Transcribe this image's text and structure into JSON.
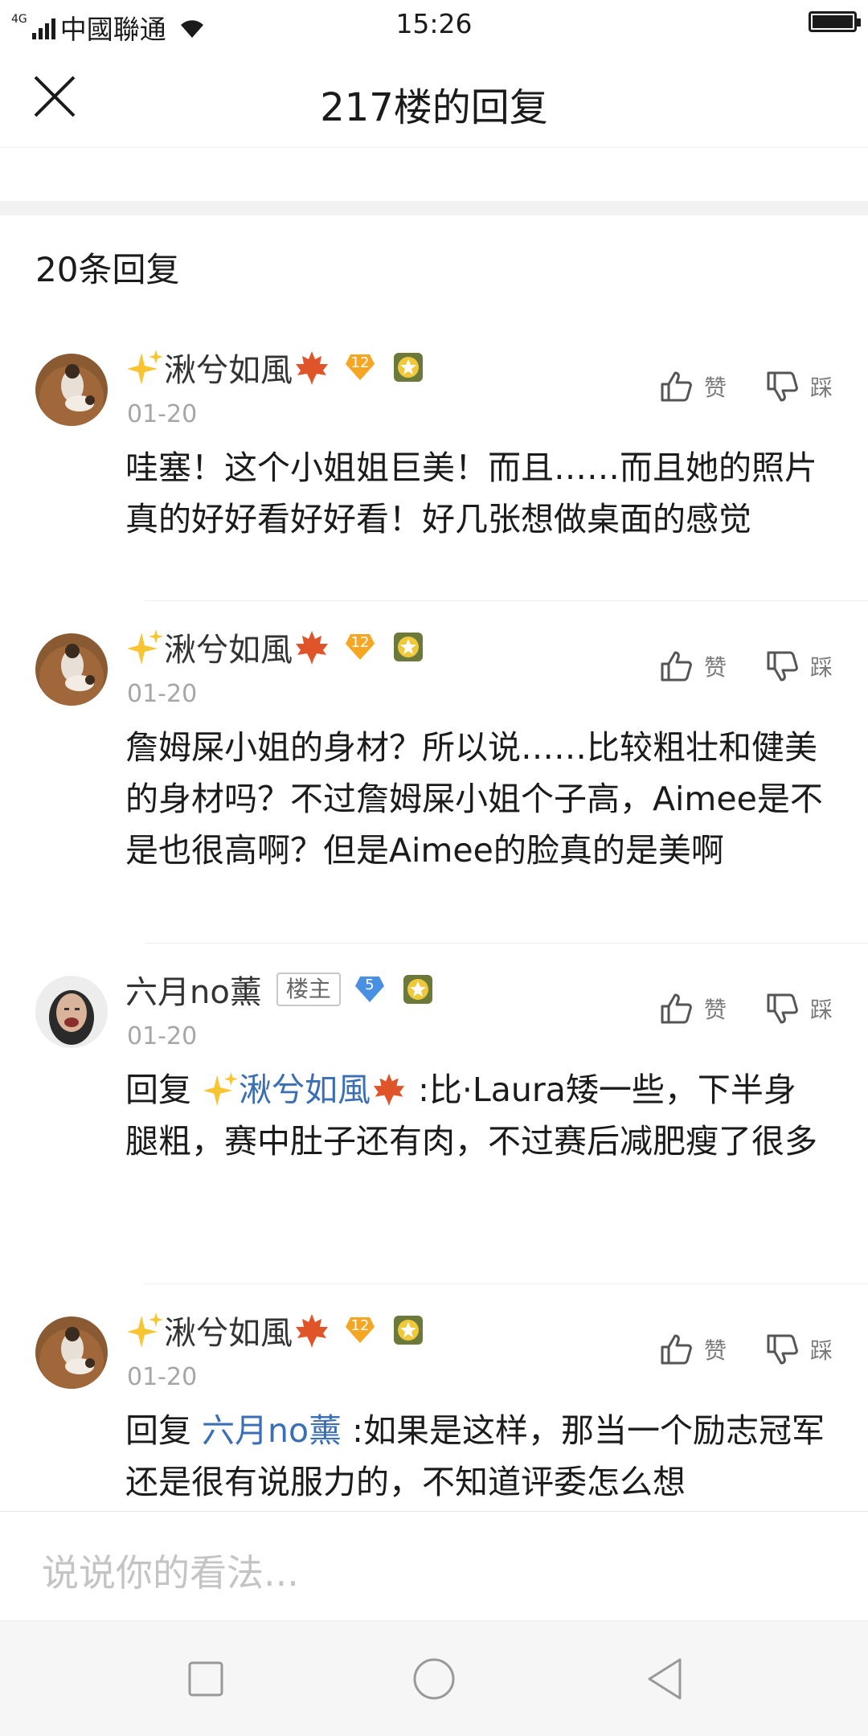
{
  "status_bar": {
    "network": "4G",
    "carrier": "中國聯通",
    "time": "15:26"
  },
  "header": {
    "title": "217楼的回复"
  },
  "reply_count": "20条回复",
  "actions": {
    "like_label": "赞",
    "dislike_label": "踩"
  },
  "comments": [
    {
      "name": "湫兮如風",
      "level": "12",
      "date": "01-20",
      "text": "哇塞！这个小姐姐巨美！而且……而且她的照片真的好好看好好看！好几张想做桌面的感觉"
    },
    {
      "name": "湫兮如風",
      "level": "12",
      "date": "01-20",
      "text": "詹姆屎小姐的身材？所以说……比较粗壮和健美的身材吗？不过詹姆屎小姐个子高，Aimee是不是也很高啊？但是Aimee的脸真的是美啊"
    },
    {
      "name": "六月no薰",
      "tag": "楼主",
      "level": "5",
      "date": "01-20",
      "reply_prefix": "回复 ",
      "mention": "湫兮如風",
      "text": " :比·Laura矮一些，下半身腿粗，赛中肚子还有肉，不过赛后减肥瘦了很多"
    },
    {
      "name": "湫兮如風",
      "level": "12",
      "date": "01-20",
      "reply_prefix": "回复 ",
      "mention": "六月no薰",
      "text": " :如果是这样，那当一个励志冠军还是很有说服力的，不知道评委怎么想"
    }
  ],
  "input": {
    "placeholder": "说说你的看法..."
  },
  "colors": {
    "mention": "#3a6fb5",
    "gold_badge": "#f5a623",
    "blue_badge": "#4a90e2"
  }
}
